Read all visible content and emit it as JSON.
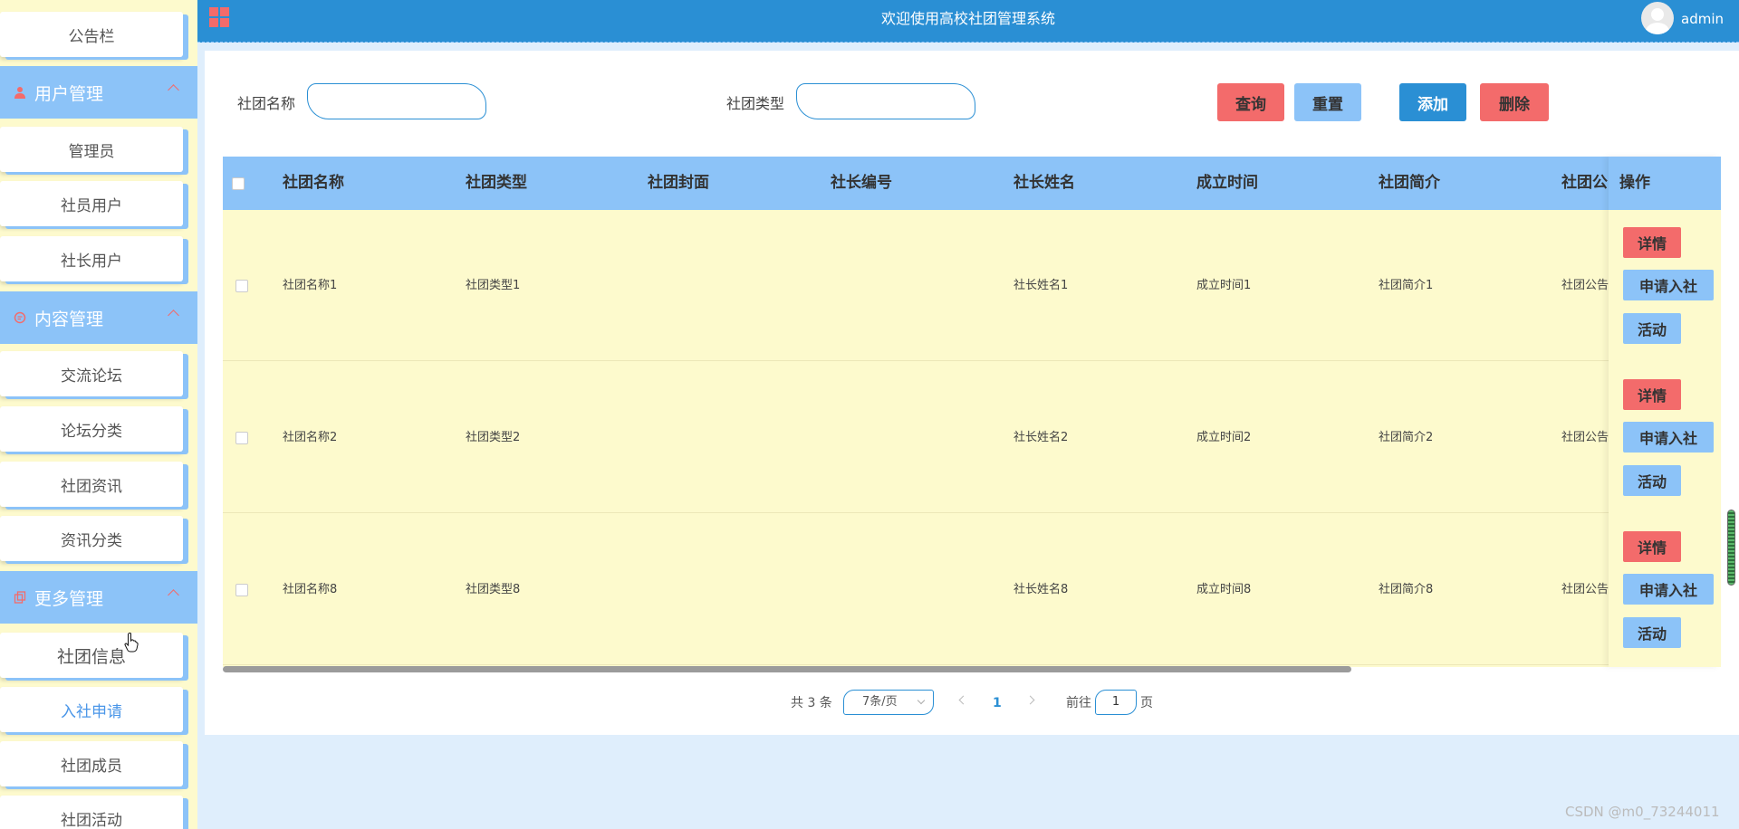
{
  "header": {
    "title": "欢迎使用高校社团管理系统",
    "user": "admin"
  },
  "sidebar": {
    "top_item": "公告栏",
    "groups": [
      {
        "label": "用户管理",
        "items": [
          "管理员",
          "社员用户",
          "社长用户"
        ]
      },
      {
        "label": "内容管理",
        "items": [
          "交流论坛",
          "论坛分类",
          "社团资讯",
          "资讯分类"
        ]
      },
      {
        "label": "更多管理",
        "items": [
          "社团信息",
          "入社申请",
          "社团成员",
          "社团活动"
        ]
      }
    ],
    "active_item": "入社申请"
  },
  "search": {
    "name_label": "社团名称",
    "type_label": "社团类型",
    "name_value": "",
    "type_value": ""
  },
  "toolbar": {
    "query": "查询",
    "reset": "重置",
    "add": "添加",
    "delete": "删除"
  },
  "table": {
    "columns": [
      "社团名称",
      "社团类型",
      "社团封面",
      "社长编号",
      "社长姓名",
      "成立时间",
      "社团简介",
      "社团公",
      "操作"
    ],
    "rows": [
      {
        "name": "社团名称1",
        "type": "社团类型1",
        "cover": "",
        "leader_id": "",
        "leader_name": "社长姓名1",
        "founded": "成立时间1",
        "intro": "社团简介1",
        "notice": "社团公告"
      },
      {
        "name": "社团名称2",
        "type": "社团类型2",
        "cover": "",
        "leader_id": "",
        "leader_name": "社长姓名2",
        "founded": "成立时间2",
        "intro": "社团简介2",
        "notice": "社团公告"
      },
      {
        "name": "社团名称8",
        "type": "社团类型8",
        "cover": "",
        "leader_id": "",
        "leader_name": "社长姓名8",
        "founded": "成立时间8",
        "intro": "社团简介8",
        "notice": "社团公告"
      }
    ],
    "row_actions": {
      "detail": "详情",
      "apply": "申请入社",
      "activity": "活动"
    }
  },
  "pagination": {
    "total": "共 3 条",
    "page_size": "7条/页",
    "current_page": "1",
    "goto_prefix": "前往",
    "goto_value": "1",
    "goto_suffix": "页"
  },
  "watermark": "CSDN @m0_73244011",
  "colors": {
    "primary": "#2a8fd4",
    "light_blue": "#8cc3f8",
    "red": "#f36b6b",
    "row_yellow": "#fdfacd",
    "page_bg": "#dfeefc"
  }
}
